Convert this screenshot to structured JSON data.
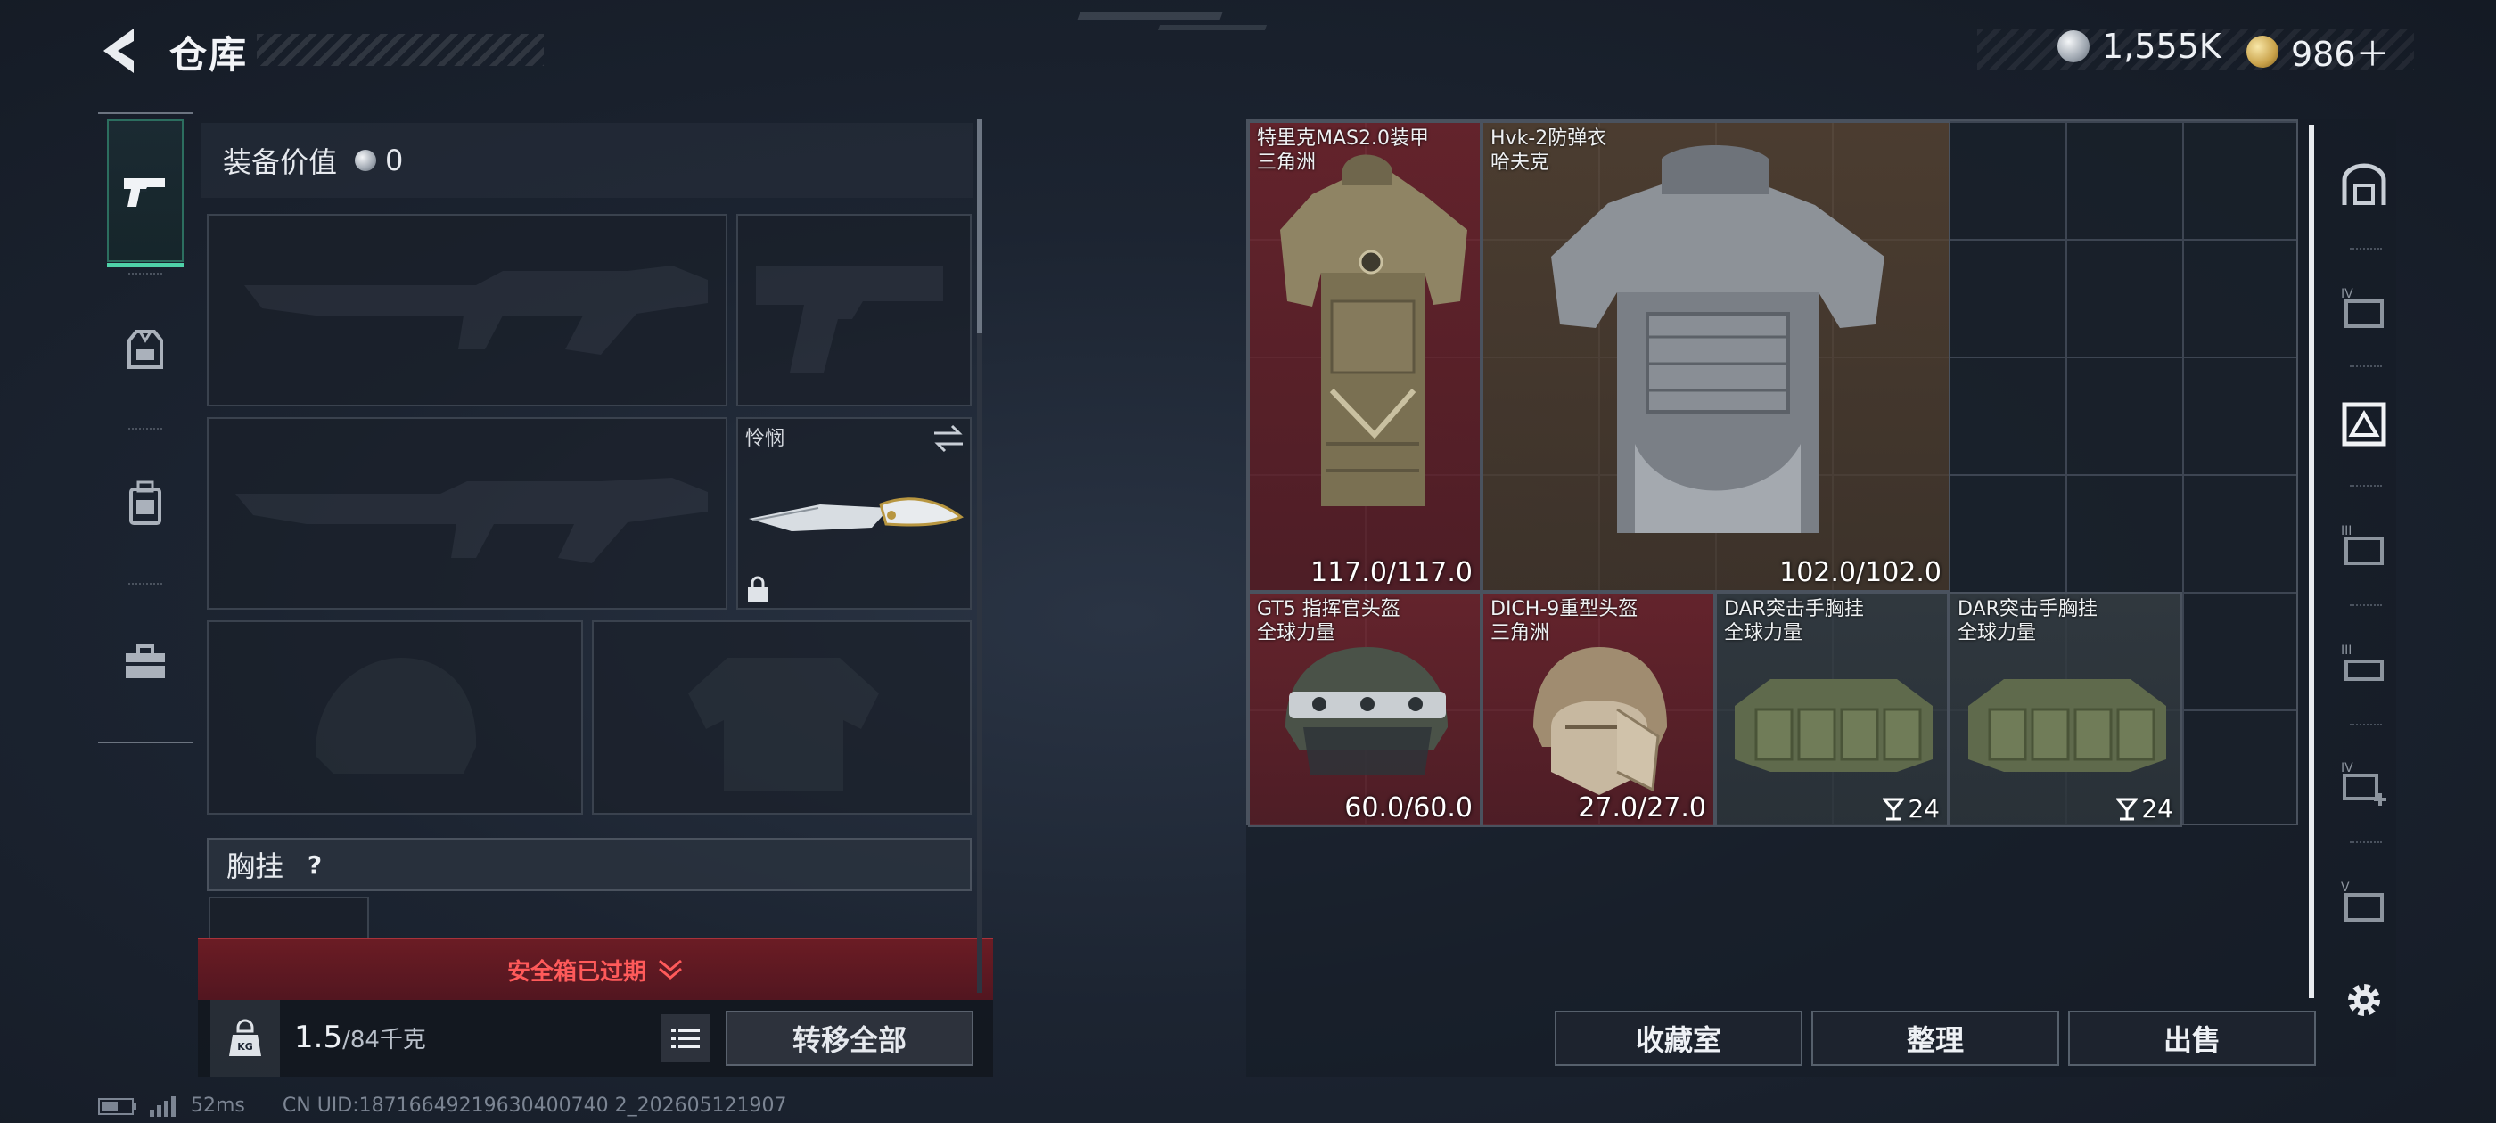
{
  "header": {
    "title": "仓库",
    "currencies": [
      {
        "name": "silver-coin",
        "value": "1,555K"
      },
      {
        "name": "gold-coin",
        "value": "986＋"
      }
    ]
  },
  "rail": {
    "items": [
      {
        "icon": "pistol-icon",
        "active": true
      },
      {
        "icon": "armor-rig-icon",
        "active": false
      },
      {
        "icon": "backpack-icon",
        "active": false
      },
      {
        "icon": "toolbox-icon",
        "active": false
      }
    ]
  },
  "equipment": {
    "value_label": "装备价值",
    "value": "0",
    "melee_name": "怜悯",
    "chest_label": "胸挂",
    "help_mark": "?",
    "safe_status": "安全箱已过期",
    "weight_current": "1.5",
    "weight_max": "/84千克",
    "move_all": "转移全部",
    "kg_icon_text": "KG"
  },
  "stash": {
    "items": [
      {
        "name": "特里克MAS2.0装甲",
        "maker": "三角洲",
        "stat": "117.0/117.0",
        "rarity": "red"
      },
      {
        "name": "Hvk-2防弹衣",
        "maker": "哈夫克",
        "stat": "102.0/102.0",
        "rarity": "brown"
      },
      {
        "name": "GT5 指挥官头盔",
        "maker": "全球力量",
        "stat": "60.0/60.0",
        "rarity": "red"
      },
      {
        "name": "DICH-9重型头盔",
        "maker": "三角洲",
        "stat": "27.0/27.0",
        "rarity": "red"
      },
      {
        "name": "DAR突击手胸挂",
        "maker": "全球力量",
        "stat": "24",
        "rarity": "green"
      },
      {
        "name": "DAR突击手胸挂",
        "maker": "全球力量",
        "stat": "24",
        "rarity": "green"
      }
    ],
    "buttons": {
      "collection": "收藏室",
      "sort": "整理",
      "sell": "出售"
    }
  },
  "status": {
    "ping": "52ms",
    "uid": "CN UID:18716649219630400740 2_202605121907"
  },
  "colors": {
    "accent_green": "#4fd1a8",
    "rarity_red": "#7a2630",
    "rarity_brown": "#5c4632",
    "alert_red": "#ff5a5a"
  }
}
